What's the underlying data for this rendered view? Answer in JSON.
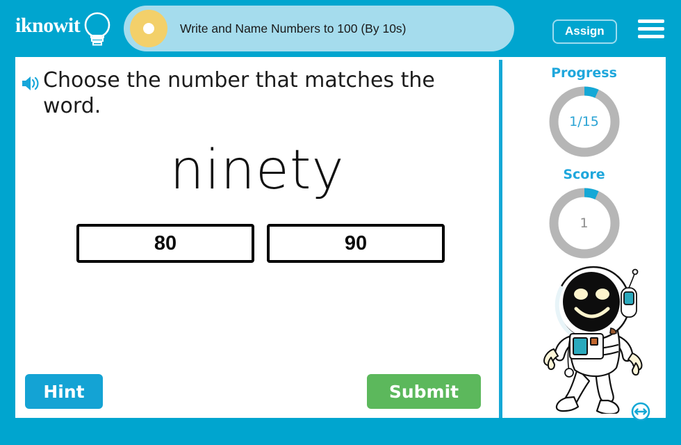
{
  "header": {
    "logo_text": "iknowit",
    "logo_icon": "lightbulb-icon",
    "lesson_title": "Write and Name Numbers to 100 (By 10s)",
    "assign_label": "Assign",
    "menu_icon": "hamburger-menu-icon",
    "bar_color": "#00a5cf",
    "pill_color": "#a5dced",
    "dot_color": "#f3d06a"
  },
  "question": {
    "audio_icon": "speaker-icon",
    "prompt": "Choose the number that matches the word.",
    "word": "ninety"
  },
  "choices": [
    {
      "label": "80"
    },
    {
      "label": "90"
    }
  ],
  "actions": {
    "hint_label": "Hint",
    "submit_label": "Submit",
    "hint_color": "#14a3d4",
    "submit_color": "#5cb85c"
  },
  "sidebar": {
    "progress": {
      "label": "Progress",
      "value": "1/15",
      "current": 1,
      "total": 15,
      "arc_color": "#14a8d6",
      "track_color": "#b6b6b6"
    },
    "score": {
      "label": "Score",
      "value": "1",
      "current": 1,
      "total": 15,
      "arc_color": "#14a8d6",
      "track_color": "#b6b6b6"
    },
    "mascot": "astronaut-character"
  },
  "footer": {
    "resize_icon": "resize-horizontal-icon",
    "icon_color": "#14a8d6"
  }
}
